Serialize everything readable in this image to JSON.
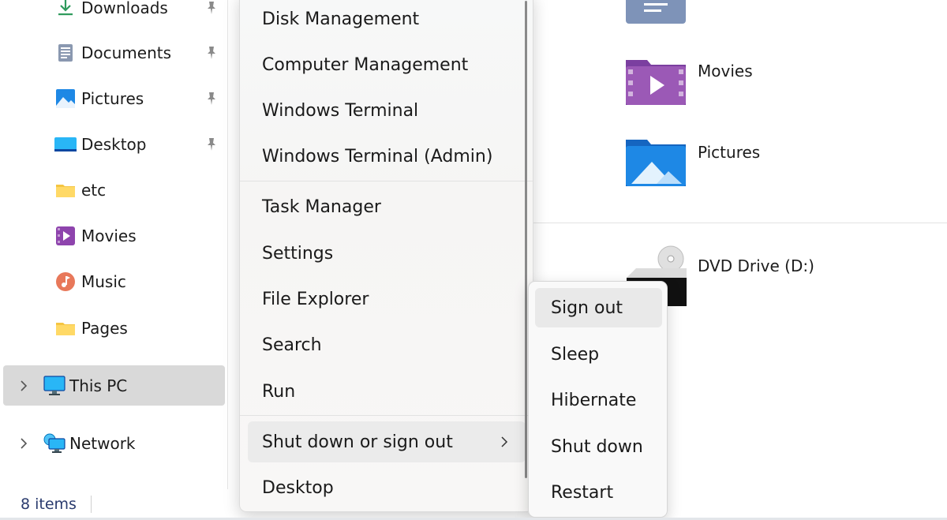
{
  "nav": {
    "quick_access": [
      {
        "label": "Downloads",
        "icon": "downloads-icon",
        "pinned": true
      },
      {
        "label": "Documents",
        "icon": "documents-icon",
        "pinned": true
      },
      {
        "label": "Pictures",
        "icon": "pictures-icon",
        "pinned": true
      },
      {
        "label": "Desktop",
        "icon": "desktop-icon",
        "pinned": true
      },
      {
        "label": "etc",
        "icon": "folder-icon",
        "pinned": false
      },
      {
        "label": "Movies",
        "icon": "movies-icon",
        "pinned": false
      },
      {
        "label": "Music",
        "icon": "music-icon",
        "pinned": false
      },
      {
        "label": "Pages",
        "icon": "folder-icon",
        "pinned": false
      }
    ],
    "this_pc": {
      "label": "This PC",
      "icon": "computer-icon",
      "selected": true
    },
    "network": {
      "label": "Network",
      "icon": "network-icon"
    }
  },
  "status": {
    "item_count": "8 items"
  },
  "content": {
    "folders": [
      {
        "label": "Movies",
        "icon": "movies-folder-icon"
      },
      {
        "label": "Pictures",
        "icon": "pictures-folder-icon"
      }
    ],
    "drives": [
      {
        "label": "DVD Drive (D:)",
        "icon": "dvd-drive-icon"
      }
    ]
  },
  "winx_menu": {
    "group1": [
      "Disk Management",
      "Computer Management",
      "Windows Terminal",
      "Windows Terminal (Admin)"
    ],
    "group2": [
      "Task Manager",
      "Settings",
      "File Explorer",
      "Search",
      "Run"
    ],
    "group3": [
      {
        "label": "Shut down or sign out",
        "has_submenu": true,
        "active": true
      },
      {
        "label": "Desktop",
        "has_submenu": false,
        "active": false
      }
    ]
  },
  "submenu": {
    "items": [
      "Sign out",
      "Sleep",
      "Hibernate",
      "Shut down",
      "Restart"
    ],
    "hovered_index": 0
  },
  "colors": {
    "accent_blue": "#1e88e5",
    "folder_yellow": "#f5c542",
    "movies_purple": "#8e44ad",
    "selection_gray": "#d9d9d9"
  }
}
